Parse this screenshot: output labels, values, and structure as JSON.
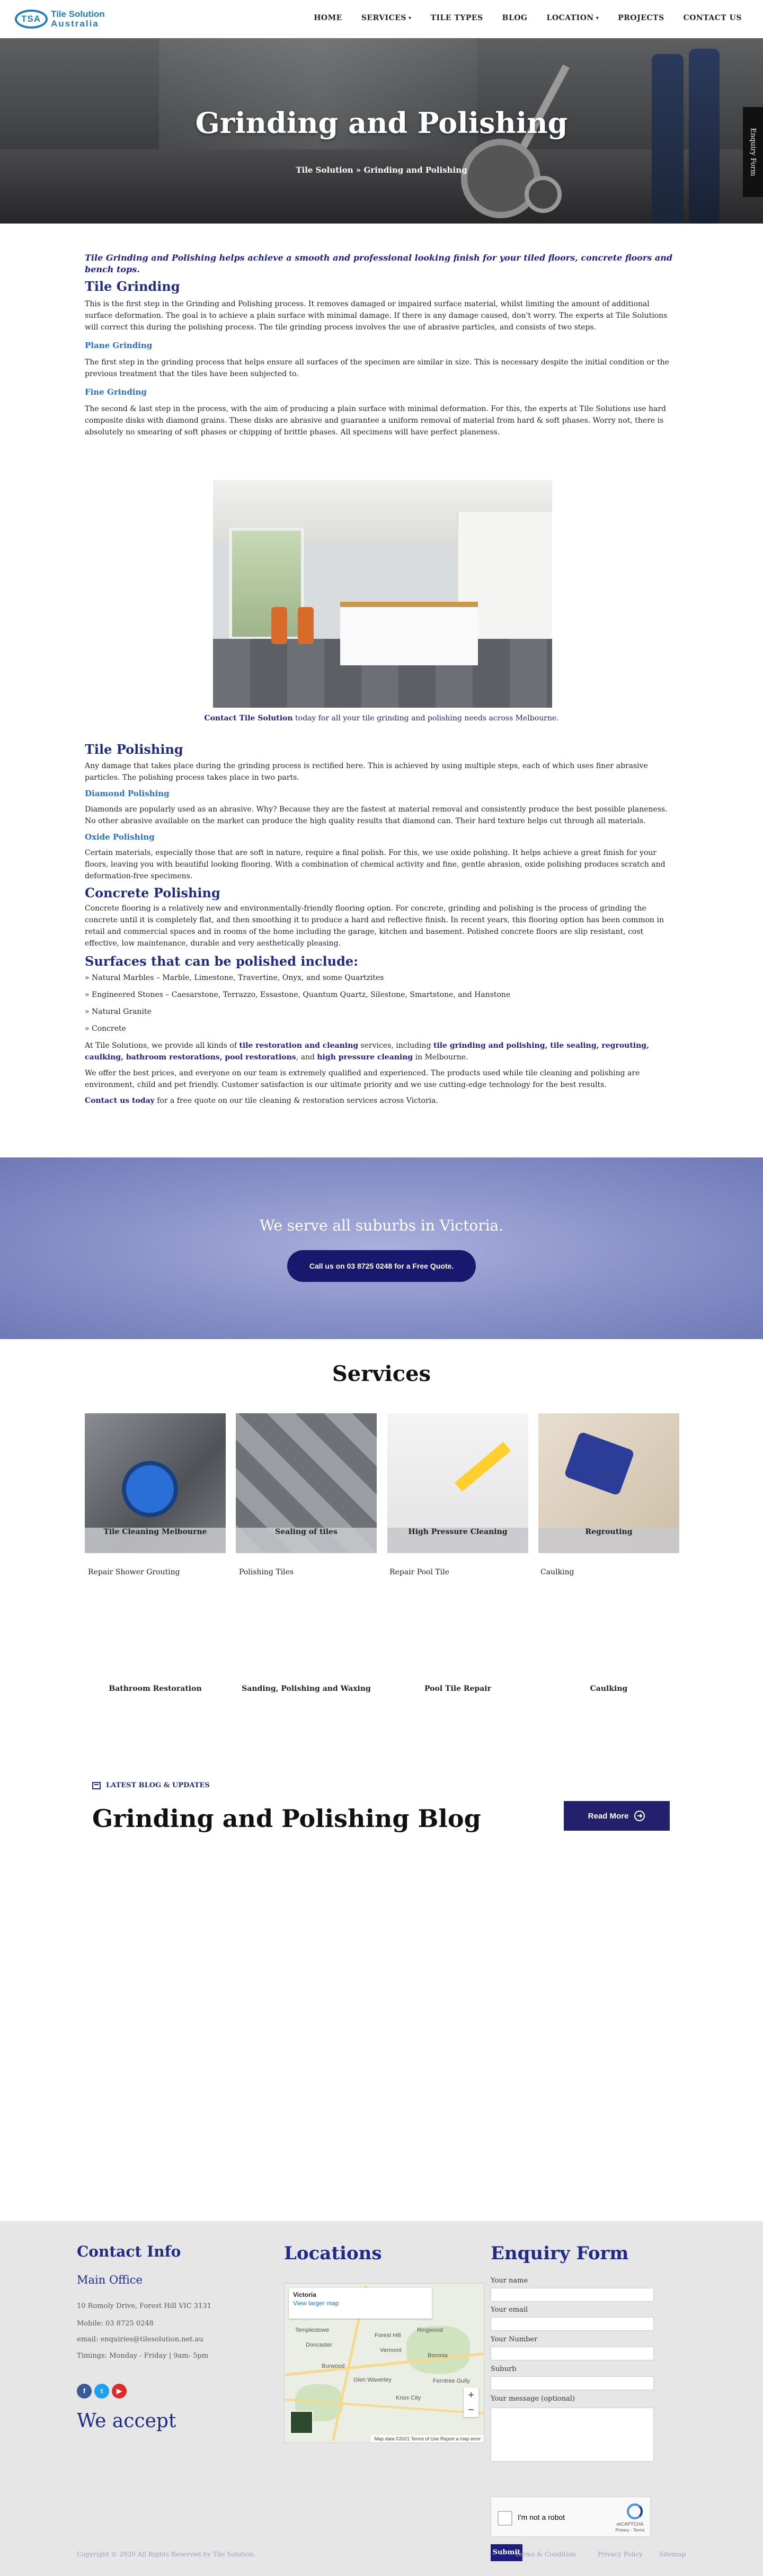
{
  "header": {
    "logo_mark": "TSA",
    "logo_line1": "Tile Solution",
    "logo_line2": "Australia",
    "nav": [
      {
        "label": "HOME"
      },
      {
        "label": "SERVICES"
      },
      {
        "label": "TILE TYPES"
      },
      {
        "label": "BLOG"
      },
      {
        "label": "LOCATION"
      },
      {
        "label": "PROJECTS"
      },
      {
        "label": "CONTACT US"
      }
    ]
  },
  "hero": {
    "title": "Grinding and Polishing",
    "breadcrumb": "Tile Solution » Grinding and Polishing",
    "enquiry_tab": "Enquiry Form"
  },
  "content": {
    "intro": "Tile Grinding and Polishing helps achieve a smooth and professional looking finish for your tiled floors, concrete floors and bench tops.",
    "tile_grinding_title": "Tile Grinding",
    "tile_grinding_p": "This is the first step in the Grinding and Polishing process. It removes damaged or impaired surface material, whilst limiting the amount of additional surface deformation. The goal is to achieve a plain surface with minimal damage. If there is any damage caused, don't worry. The experts at Tile Solutions will correct this during the polishing process. The tile grinding process involves the use of abrasive particles, and consists of two steps.",
    "plane_grinding_title": "Plane Grinding",
    "plane_grinding_p": "The first step in the grinding process that helps ensure all surfaces of the specimen are similar in size. This is necessary despite the initial condition or the previous treatment that the tiles have been subjected to.",
    "fine_grinding_title": "Fine Grinding",
    "fine_grinding_p": "The second & last step in the process, with the aim of producing a plain surface with minimal deformation. For this, the experts at Tile Solutions use hard composite disks with diamond grains. These disks are abrasive and guarantee a uniform removal of material from hard & soft phases. Worry not, there is absolutely no smearing of soft phases or chipping of brittle phases. All specimens will have perfect planeness.",
    "photo_caption_link": "Contact Tile Solution",
    "photo_caption_rest": " today for all your tile grinding and polishing needs across Melbourne.",
    "tile_polishing_title": "Tile Polishing",
    "tile_polishing_p": "Any damage that takes place during the grinding process is rectified here. This is achieved by using multiple steps, each of which uses finer abrasive particles. The polishing process takes place in two parts.",
    "diamond_title": "Diamond Polishing",
    "diamond_p": "Diamonds are popularly used as an abrasive. Why? Because they are the fastest at material removal and consistently produce the best possible planeness. No other abrasive available on the market can produce the high quality results that diamond can. Their hard texture helps cut through all materials.",
    "oxide_title": "Oxide Polishing",
    "oxide_p": "Certain materials, especially those that are soft in nature, require a final polish. For this, we use oxide polishing. It helps achieve a great finish for your floors, leaving you with beautiful looking flooring. With a combination of chemical activity and fine, gentle abrasion, oxide polishing produces scratch and deformation-free specimens.",
    "concrete_title": "Concrete Polishing",
    "concrete_p": "Concrete flooring is a relatively new and environmentally-friendly flooring option. For concrete, grinding and polishing is the process of grinding the concrete until it is completely flat, and then smoothing it to produce a hard and reflective finish. In recent years, this flooring option has been common in retail and commercial spaces and in rooms of the home including the garage, kitchen and basement. Polished concrete floors are slip resistant, cost effective, low maintenance, durable and very aesthetically pleasing.",
    "surfaces_title": "Surfaces that can be polished include:",
    "surfaces": [
      "» Natural Marbles – Marble, Limestone, Travertine, Onyx, and some Quartzites",
      "» Engineered Stones – Caesarstone, Terrazzo, Essastone, Quantum Quartz, Silestone, Smartstone, and Hanstone",
      "» Natural Granite",
      "» Concrete"
    ],
    "services_p_1": "At Tile Solutions, we provide all kinds of ",
    "services_p_link1": "tile restoration and cleaning",
    "services_p_2": " services, including ",
    "services_p_link2": "tile grinding and polishing, tile sealing, regrouting, caulking, bathroom restorations, pool restorations",
    "services_p_3": ", and ",
    "services_p_link3": "high pressure cleaning",
    "services_p_4": " in Melbourne.",
    "prices_p": "We offer the best prices, and everyone on our team is extremely qualified and experienced. The products used while tile cleaning and polishing are environment, child and pet friendly. Customer satisfaction is our ultimate priority and we use cutting-edge technology for the best results.",
    "contact_link": "Contact us today",
    "contact_rest": " for a free quote on our tile cleaning & restoration services across Victoria."
  },
  "banner": {
    "title": "We serve all suburbs in Victoria.",
    "button": "Call us on 03 8725 0248 for a Free Quote."
  },
  "services": {
    "title": "Services",
    "cards": [
      {
        "label": "Tile Cleaning Melbourne"
      },
      {
        "label": "Sealing of tiles"
      },
      {
        "label": "High Pressure Cleaning"
      },
      {
        "label": "Regrouting"
      }
    ],
    "row2": [
      "Repair Shower Grouting",
      "Polishing Tiles",
      "Repair Pool Tile",
      "Caulking"
    ],
    "row3": [
      "Bathroom Restoration",
      "Sanding, Polishing and Waxing",
      "Pool Tile Repair",
      "Caulking"
    ]
  },
  "blog": {
    "tag": "LATEST BLOG & UPDATES",
    "title": "Grinding and Polishing Blog",
    "read_more": "Read More"
  },
  "footer": {
    "contact_title": "Contact Info",
    "office_title": "Main Office",
    "address": "10 Romoly Drive, Forest Hill VIC 3131",
    "mobile": "Mobile: 03 8725 0248",
    "email": "email: enquiries@tilesolution.net.au",
    "timings": "Timings: Monday - Friday | 9am- 5pm",
    "accept_title": "We accept",
    "locations_title": "Locations",
    "map_place": "Victoria",
    "map_link": "View larger map",
    "map_footer": "Map data ©2021   Terms of Use   Report a map error",
    "map_towns": [
      "Forest Hill",
      "Ringwood",
      "Boronia",
      "Vermont",
      "Templestowe",
      "Glen Waverley",
      "Doncaster",
      "Burwood",
      "Knox City",
      "Ferntree Gully"
    ],
    "enquiry_title": "Enquiry Form",
    "form": {
      "name": "Your name",
      "email": "Your email",
      "number": "Your Number",
      "suburb": "Suburb",
      "message": "Your message (optional)"
    },
    "captcha": "I'm not a robot",
    "captcha_brand": "reCAPTCHA",
    "captcha_terms": "Privacy - Terms",
    "submit": "Submit",
    "copyright": "Copyright © 2020 All Rights Reserved by Tile Solution.",
    "links": [
      "Terms & Condition",
      "Privacy Policy",
      "Sitemap"
    ]
  },
  "colors": {
    "brand_blue": "#1d2b8a",
    "banner_button": "#17186e",
    "link_blue": "#2a6fd6"
  }
}
